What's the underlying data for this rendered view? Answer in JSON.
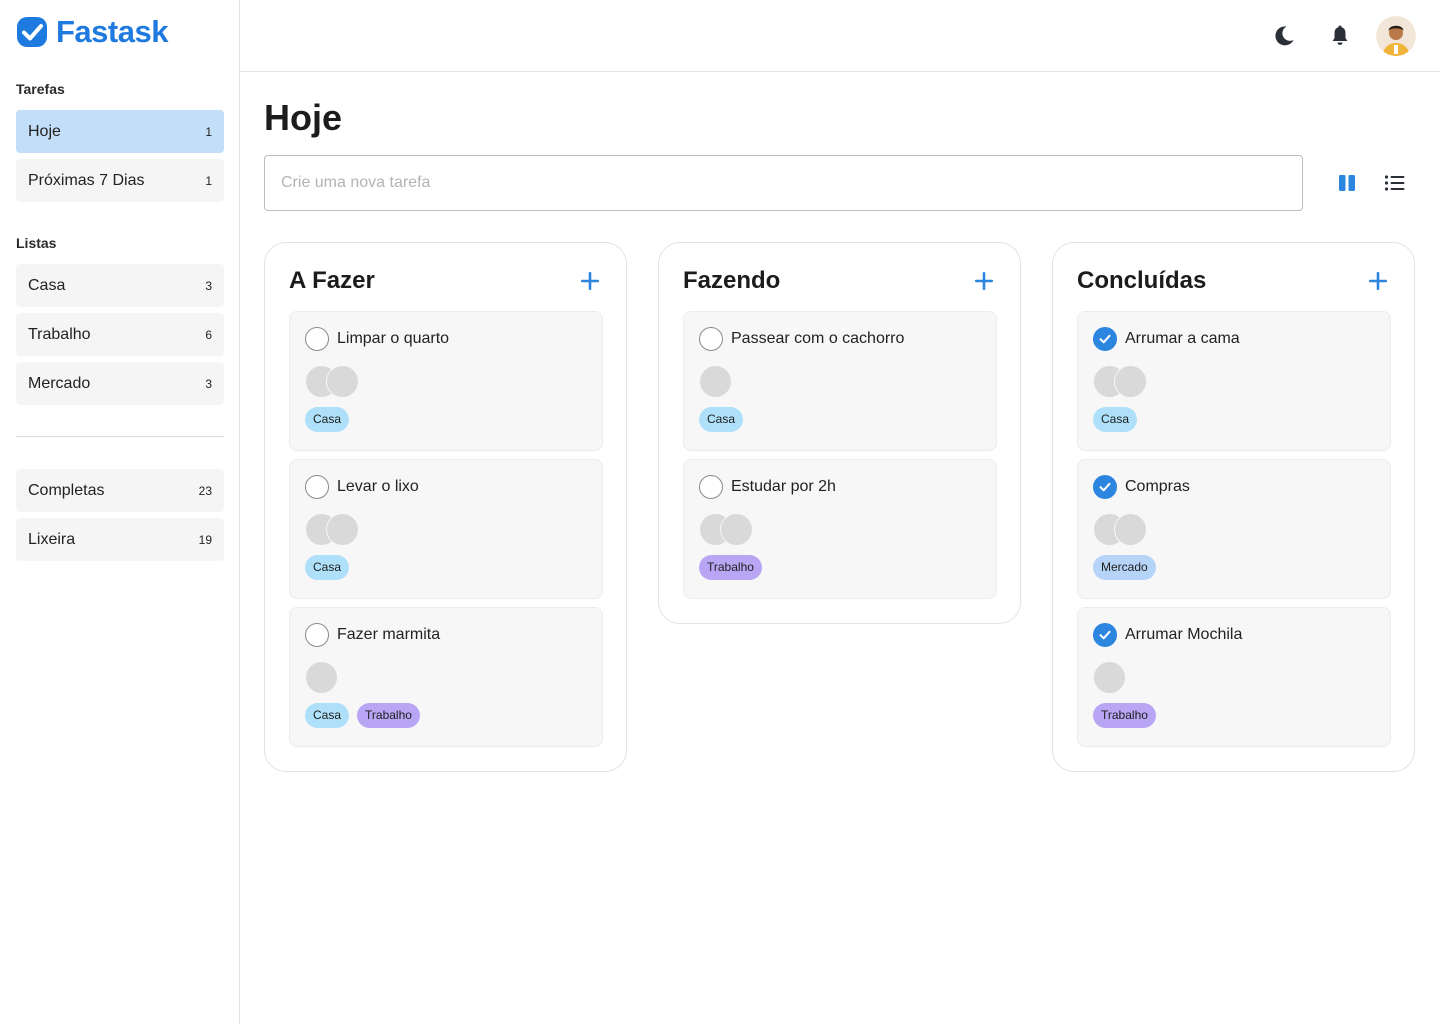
{
  "app": {
    "name": "Fastask"
  },
  "sidebar": {
    "tasks_title": "Tarefas",
    "task_items": [
      {
        "label": "Hoje",
        "count": "1",
        "active": true
      },
      {
        "label": "Próximas 7 Dias",
        "count": "1",
        "active": false
      }
    ],
    "lists_title": "Listas",
    "list_items": [
      {
        "label": "Casa",
        "count": "3"
      },
      {
        "label": "Trabalho",
        "count": "6"
      },
      {
        "label": "Mercado",
        "count": "3"
      }
    ],
    "extra_items": [
      {
        "label": "Completas",
        "count": "23"
      },
      {
        "label": "Lixeira",
        "count": "19"
      }
    ]
  },
  "header": {
    "icons": [
      "moon-icon",
      "bell-icon"
    ],
    "avatar": "user-avatar"
  },
  "main": {
    "title": "Hoje",
    "new_task_placeholder": "Crie uma nova tarefa",
    "view_icons": [
      "board-view-icon",
      "list-view-icon"
    ]
  },
  "colors": {
    "brand": "#1f7ae0",
    "active_nav": "#c3def8",
    "check_done": "#2c86e0",
    "tag_casa": "#aee0fa",
    "tag_trabalho": "#b8a6f5",
    "tag_mercado": "#b6d4f8"
  },
  "columns": [
    {
      "title": "A Fazer",
      "cards": [
        {
          "title": "Limpar o quarto",
          "done": false,
          "members": 2,
          "tags": [
            "Casa"
          ]
        },
        {
          "title": "Levar o lixo",
          "done": false,
          "members": 2,
          "tags": [
            "Casa"
          ]
        },
        {
          "title": "Fazer marmita",
          "done": false,
          "members": 1,
          "tags": [
            "Casa",
            "Trabalho"
          ]
        }
      ]
    },
    {
      "title": "Fazendo",
      "cards": [
        {
          "title": "Passear com o cachorro",
          "done": false,
          "members": 1,
          "tags": [
            "Casa"
          ]
        },
        {
          "title": "Estudar por 2h",
          "done": false,
          "members": 2,
          "tags": [
            "Trabalho"
          ]
        }
      ]
    },
    {
      "title": "Concluídas",
      "cards": [
        {
          "title": "Arrumar a cama",
          "done": true,
          "members": 2,
          "tags": [
            "Casa"
          ]
        },
        {
          "title": "Compras",
          "done": true,
          "members": 2,
          "tags": [
            "Mercado"
          ]
        },
        {
          "title": "Arrumar Mochila",
          "done": true,
          "members": 1,
          "tags": [
            "Trabalho"
          ]
        }
      ]
    }
  ]
}
